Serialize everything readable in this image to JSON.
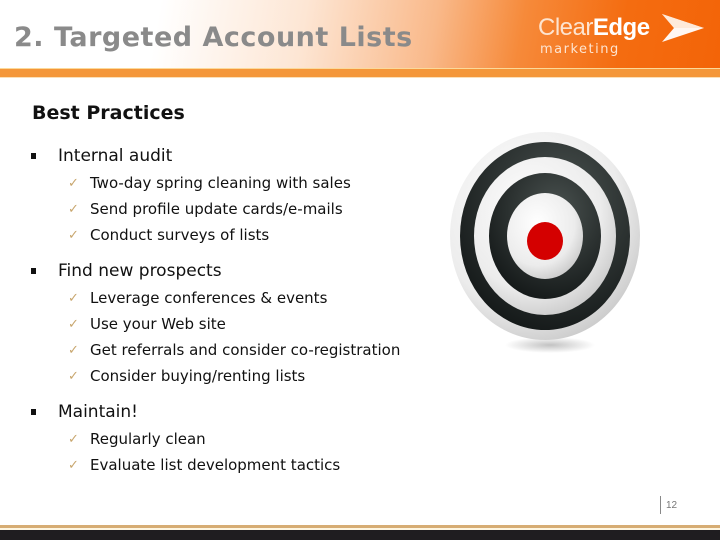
{
  "header": {
    "title": "2. Targeted Account Lists",
    "logo": {
      "word1": "Clear",
      "word2": "Edge",
      "tagline": "marketing",
      "icon": "arrow-chevron-icon"
    }
  },
  "content": {
    "heading": "Best Practices",
    "sections": [
      {
        "label": "Internal audit",
        "items": [
          "Two-day spring cleaning with sales",
          "Send profile update cards/e-mails",
          "Conduct surveys of lists"
        ]
      },
      {
        "label": "Find new prospects",
        "items": [
          "Leverage conferences & events",
          "Use your Web site",
          "Get referrals and consider co-registration",
          "Consider buying/renting lists"
        ]
      },
      {
        "label": "Maintain!",
        "items": [
          "Regularly clean",
          "Evaluate list development tactics"
        ]
      }
    ],
    "check_glyph": "✓",
    "image": "target-bullseye-icon"
  },
  "footer": {
    "page_number": "12"
  },
  "colors": {
    "accent_orange": "#f46c10",
    "bullseye_red": "#d40000",
    "check_gold": "#c8a66e"
  }
}
